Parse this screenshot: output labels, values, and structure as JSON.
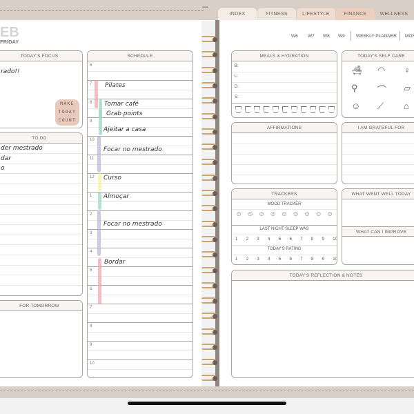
{
  "tabs": [
    {
      "label": "INDEX",
      "color": "#f3ede6"
    },
    {
      "label": "FITNESS",
      "color": "#efe6dd"
    },
    {
      "label": "LIFESTYLE",
      "color": "#f0ddd1"
    },
    {
      "label": "FINANCE",
      "color": "#ebcfbf"
    },
    {
      "label": "WELLNESS",
      "color": "#d9cfc6"
    }
  ],
  "header": {
    "month": "EB",
    "weekday": "FRIDAY"
  },
  "nav": {
    "weeks": [
      "W6",
      "W7",
      "W8",
      "W9"
    ],
    "weekly": "WEEKLY PLANNER",
    "monthly": "MON"
  },
  "focus": {
    "title": "TODAY'S FOCUS",
    "text": "rado!!",
    "badge": [
      "MAKE",
      "TODAY",
      "COUNT"
    ]
  },
  "todo": {
    "title": "TO DO",
    "items": [
      "der mestrado",
      "dar",
      "o"
    ]
  },
  "tomorrow": {
    "title": "FOR TOMORROW"
  },
  "schedule": {
    "title": "SCHEDULE",
    "hours": [
      "6",
      "7",
      "8",
      "9",
      "10",
      "11",
      "12",
      "1",
      "2",
      "3",
      "4",
      "5",
      "6",
      "7",
      "8",
      "9",
      "10"
    ],
    "events": [
      "Pilates",
      "Tomar café",
      "Grab points",
      "Ajeitar a casa",
      "Focar no mestrado",
      "Curso",
      "Almoçar",
      "Focar no mestrado",
      "Bordar"
    ],
    "colors": {
      "pink": "#f2a7b0",
      "teal": "#9fd8c4",
      "blue": "#c8d6e0",
      "purple": "#c4b6d8",
      "yellow": "#f6f0a0"
    }
  },
  "meals": {
    "title": "MEALS & HYDRATION",
    "rows": [
      "B:",
      "L:",
      "D:",
      "S:"
    ],
    "cups": 11
  },
  "selfcare": {
    "title": "TODAY'S SELF CARE",
    "icons": [
      "bathtub-icon",
      "sleep-mask-icon",
      "mirror-icon",
      "dumbbell-icon",
      "shower-icon",
      "lotion-tube-icon",
      "face-mask-icon",
      "tweezers-icon",
      "nail-polish-icon"
    ]
  },
  "affirmations": {
    "title": "AFFIRMATIONS"
  },
  "grateful": {
    "title": "I AM GRATEFUL FOR"
  },
  "trackers": {
    "title": "TRACKERS",
    "mood": "MOOD TRACKER",
    "sleep": "LAST NIGHT SLEEP WAS",
    "rating": "TODAY'S RATING",
    "scale": [
      "1",
      "2",
      "3",
      "4",
      "5",
      "6",
      "7",
      "8",
      "9",
      "10"
    ],
    "faces": 9
  },
  "went_well": {
    "title": "WHAT WENT WELL TODAY"
  },
  "improve": {
    "title": "WHAT CAN I IMPROVE"
  },
  "reflection": {
    "title": "TODAY'S REFLECTION & NOTES"
  }
}
